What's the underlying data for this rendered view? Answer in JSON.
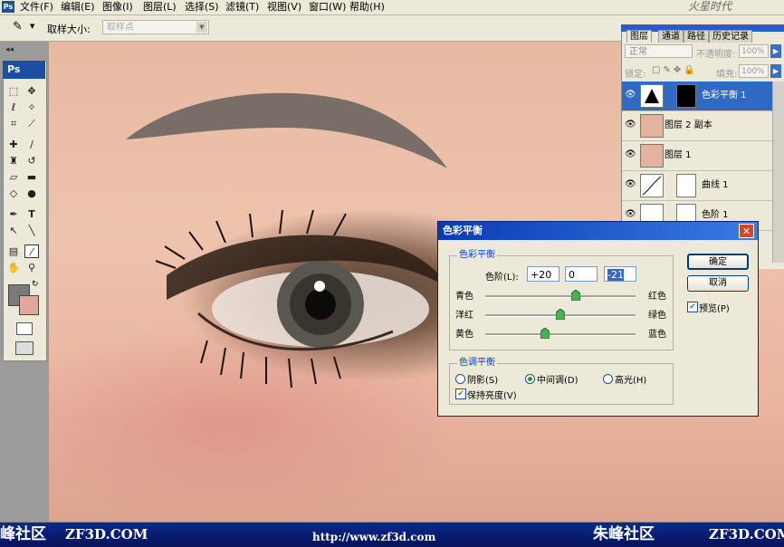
{
  "menu": {
    "app_icon": "Ps",
    "items": [
      "文件(F)",
      "编辑(E)",
      "图像(I)",
      "图层(L)",
      "选择(S)",
      "滤镜(T)",
      "视图(V)",
      "窗口(W)",
      "帮助(H)"
    ]
  },
  "watermark_top": "火星时代",
  "options_bar": {
    "tool_icon": "eyedropper-icon",
    "sample_size_label": "取样大小:",
    "sample_size_value": "取样点"
  },
  "toolbox": {
    "header": "Ps",
    "icons": [
      "marquee-icon",
      "move-icon",
      "lasso-icon",
      "magic-wand-icon",
      "crop-icon",
      "slice-icon",
      "healing-icon",
      "brush-icon",
      "stamp-icon",
      "history-brush-icon",
      "eraser-icon",
      "gradient-icon",
      "blur-icon",
      "dodge-icon",
      "pen-icon",
      "type-icon",
      "path-select-icon",
      "line-icon",
      "notes-icon",
      "eyedropper-icon",
      "hand-icon",
      "zoom-icon"
    ],
    "foreground_color": "#7a7a7a",
    "background_color": "#e0a89a"
  },
  "layers_panel": {
    "tabs": [
      "图层",
      "通道",
      "路径",
      "历史记录"
    ],
    "blend_mode": "正常",
    "opacity_label": "不透明度:",
    "opacity_value": "100%",
    "lock_label": "锁定:",
    "fill_label": "填充:",
    "fill_value": "100%",
    "layers": [
      {
        "name": "色彩平衡 1",
        "selected": true
      },
      {
        "name": "图层 2 副本",
        "selected": false
      },
      {
        "name": "图层 1",
        "selected": false
      },
      {
        "name": "曲线 1",
        "selected": false
      },
      {
        "name": "色阶 1",
        "selected": false
      }
    ]
  },
  "dialog": {
    "title": "色彩平衡",
    "color_balance_group": "色彩平衡",
    "levels_label": "色阶(L):",
    "levels_values": [
      "+20",
      "0",
      "-21"
    ],
    "sliders": [
      {
        "left": "青色",
        "right": "红色",
        "value": 20
      },
      {
        "left": "洋红",
        "right": "绿色",
        "value": 0
      },
      {
        "left": "黄色",
        "right": "蓝色",
        "value": -21
      }
    ],
    "tone_group": "色调平衡",
    "tones": [
      {
        "label": "阴影(S)",
        "selected": false
      },
      {
        "label": "中间调(D)",
        "selected": true
      },
      {
        "label": "高光(H)",
        "selected": false
      }
    ],
    "preserve_luminosity": "保持亮度(V)",
    "ok": "确定",
    "cancel": "取消",
    "preview": "预览(P)"
  },
  "footer": {
    "left_fragment": "峰社区",
    "left_site": "ZF3D.COM",
    "url": "http://www.zf3d.com",
    "brand": "朱峰社区",
    "right_site": "ZF3D.COM"
  },
  "colors": {
    "title_blue": "#0a3bb0",
    "selection_blue": "#316ac5",
    "skin": "#eec3ac"
  }
}
